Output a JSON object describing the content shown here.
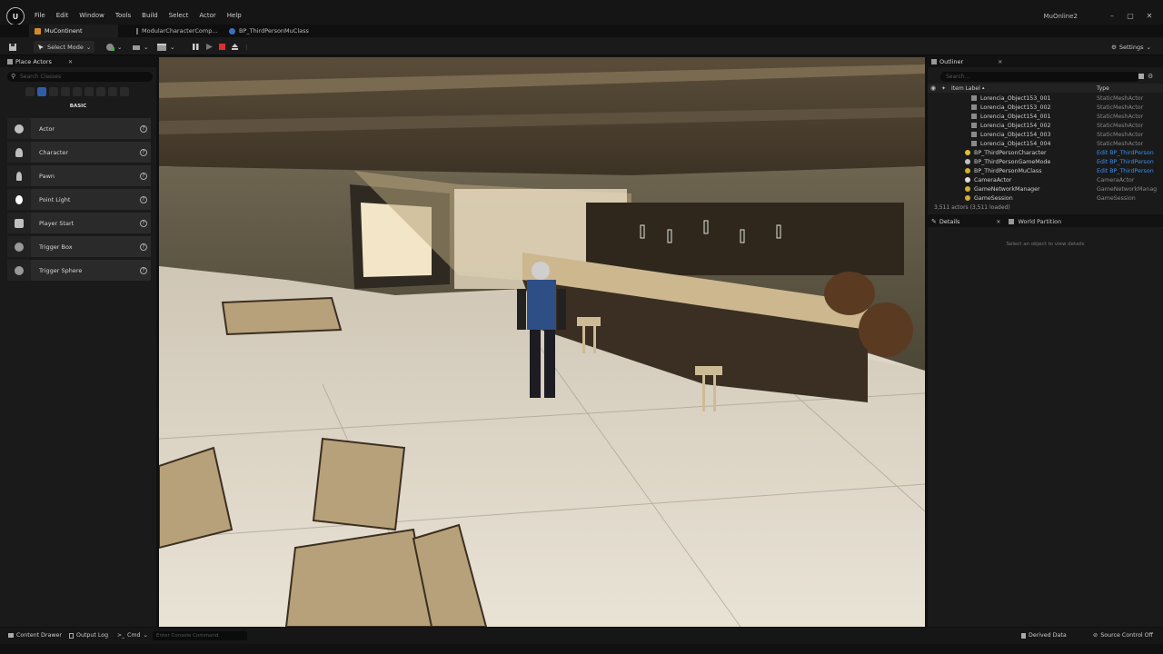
{
  "window": {
    "project_name": "MuOnline2",
    "menu": [
      "File",
      "Edit",
      "Window",
      "Tools",
      "Build",
      "Select",
      "Actor",
      "Help"
    ],
    "controls": {
      "minimize": "–",
      "maximize": "▢",
      "close": "✕"
    }
  },
  "tabs": [
    {
      "label": "MuContinent",
      "active": true
    },
    {
      "label": "ModularCharacterComp...",
      "active": false
    },
    {
      "label": "BP_ThirdPersonMuClass",
      "active": false
    }
  ],
  "toolbar": {
    "mode_label": "Select Mode",
    "settings_label": "Settings",
    "play_controls": [
      "pause",
      "resume",
      "stop",
      "eject"
    ],
    "colors": {
      "stop": "#d9302f",
      "accent": "#2f5ea8"
    }
  },
  "place_actors": {
    "title": "Place Actors",
    "search_placeholder": "Search Classes",
    "section": "BASIC",
    "items": [
      {
        "label": "Actor",
        "icon": "actor-sphere-icon"
      },
      {
        "label": "Character",
        "icon": "character-icon"
      },
      {
        "label": "Pawn",
        "icon": "pawn-icon"
      },
      {
        "label": "Point Light",
        "icon": "point-light-icon"
      },
      {
        "label": "Player Start",
        "icon": "player-start-icon"
      },
      {
        "label": "Trigger Box",
        "icon": "trigger-box-icon"
      },
      {
        "label": "Trigger Sphere",
        "icon": "trigger-sphere-icon"
      }
    ]
  },
  "outliner": {
    "title": "Outliner",
    "search_placeholder": "Search...",
    "col_label": "Item Label",
    "col_type": "Type",
    "rows": [
      {
        "name": "Lorencia_Object153_001",
        "type": "StaticMeshActor",
        "link": false,
        "icon": "static-mesh-icon"
      },
      {
        "name": "Lorencia_Object153_002",
        "type": "StaticMeshActor",
        "link": false,
        "icon": "static-mesh-icon"
      },
      {
        "name": "Lorencia_Object154_001",
        "type": "StaticMeshActor",
        "link": false,
        "icon": "static-mesh-icon"
      },
      {
        "name": "Lorencia_Object154_002",
        "type": "StaticMeshActor",
        "link": false,
        "icon": "static-mesh-icon"
      },
      {
        "name": "Lorencia_Object154_003",
        "type": "StaticMeshActor",
        "link": false,
        "icon": "static-mesh-icon"
      },
      {
        "name": "Lorencia_Object154_004",
        "type": "StaticMeshActor",
        "link": false,
        "icon": "static-mesh-icon"
      },
      {
        "name": "BP_ThirdPersonCharacter",
        "type": "Edit BP_ThirdPerson",
        "link": true,
        "icon": "character-icon"
      },
      {
        "name": "BP_ThirdPersonGameMode",
        "type": "Edit BP_ThirdPerson",
        "link": true,
        "icon": "game-mode-icon"
      },
      {
        "name": "BP_ThirdPersonMuClass",
        "type": "Edit BP_ThirdPerson",
        "link": true,
        "icon": "actor-icon"
      },
      {
        "name": "CameraActor",
        "type": "CameraActor",
        "link": false,
        "icon": "camera-icon"
      },
      {
        "name": "GameNetworkManager",
        "type": "GameNetworkManag",
        "link": false,
        "icon": "actor-icon"
      },
      {
        "name": "GameSession",
        "type": "GameSession",
        "link": false,
        "icon": "actor-icon"
      }
    ],
    "count": "3,511 actors (3,511 loaded)"
  },
  "details": {
    "tab_details": "Details",
    "tab_world": "World Partition",
    "empty_text": "Select an object to view details"
  },
  "bottom": {
    "content_drawer": "Content Drawer",
    "output_log": "Output Log",
    "cmd": "Cmd",
    "console_placeholder": "Enter Console Command",
    "derived_data": "Derived Data",
    "source_control": "Source Control Off"
  }
}
